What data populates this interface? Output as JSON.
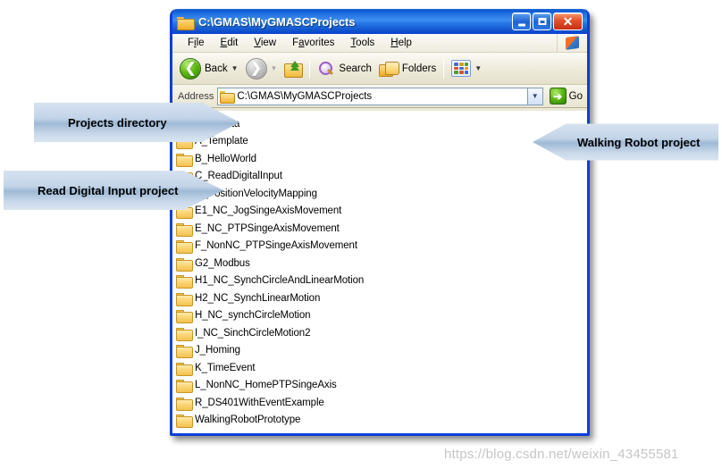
{
  "window": {
    "title": "C:\\GMAS\\MyGMASCProjects",
    "title_icon": "folder-icon",
    "buttons": {
      "minimize": "_",
      "maximize": "□",
      "close": "✕"
    }
  },
  "menu": {
    "items": [
      {
        "pre": "F",
        "accel": "i",
        "post": "le",
        "label": "File"
      },
      {
        "pre": "",
        "accel": "E",
        "post": "dit",
        "label": "Edit"
      },
      {
        "pre": "",
        "accel": "V",
        "post": "iew",
        "label": "View"
      },
      {
        "pre": "F",
        "accel": "a",
        "post": "vorites",
        "label": "Favorites"
      },
      {
        "pre": "",
        "accel": "T",
        "post": "ools",
        "label": "Tools"
      },
      {
        "pre": "",
        "accel": "H",
        "post": "elp",
        "label": "Help"
      }
    ],
    "logo": "windows-flag-icon"
  },
  "toolbar": {
    "back_label": "Back",
    "back_icon": "back-arrow-icon",
    "forward_icon": "forward-arrow-icon",
    "up_icon": "up-folder-icon",
    "search_label": "Search",
    "search_icon": "search-icon",
    "folders_label": "Folders",
    "folders_icon": "folders-icon",
    "views_icon": "views-icon",
    "dropdown_caret": "▼"
  },
  "address_bar": {
    "label": "Address",
    "value": "C:\\GMAS\\MyGMASCProjects",
    "placeholder": "C:\\GMAS\\MyGMASCProjects",
    "folder_icon": "folder-icon",
    "dropdown_caret": "▼",
    "go_label": "Go",
    "go_icon": "go-arrow-icon"
  },
  "file_list": {
    "column_one": [
      ".metadata",
      "A_Template",
      "B_HelloWorld",
      "C_ReadDigitalInput",
      "D_PositionVelocityMapping",
      "E1_NC_JogSingeAxisMovement",
      "E_NC_PTPSingeAxisMovement",
      "F_NonNC_PTPSingeAxisMovement",
      "G2_Modbus",
      "H1_NC_SynchCircleAndLinearMotion",
      "H2_NC_SynchLinearMotion",
      "H_NC_synchCircleMotion",
      "I_NC_SinchCircleMotion2",
      "J_Homing",
      "K_TimeEvent",
      "L_NonNC_HomePTPSingeAxis",
      "R_DS401WithEventExample"
    ],
    "column_two": [
      "WalkingRobotPrototype"
    ]
  },
  "callouts": [
    {
      "id": "projects",
      "text": "Projects directory",
      "direction": "right"
    },
    {
      "id": "readdi",
      "text": "Read Digital Input project",
      "direction": "right"
    },
    {
      "id": "walking",
      "text": "Walking Robot project",
      "direction": "left"
    }
  ],
  "watermark": {
    "text": "https://blog.csdn.net/weixin_43455581"
  },
  "colors": {
    "title_blue": "#0b3fd6",
    "window_border": "#0b3fd6",
    "toolbar_beige": "#ece9d8",
    "callout_blue": "#c3d4e8",
    "folder_yellow": "#f3c152",
    "back_green": "#56b40f"
  }
}
